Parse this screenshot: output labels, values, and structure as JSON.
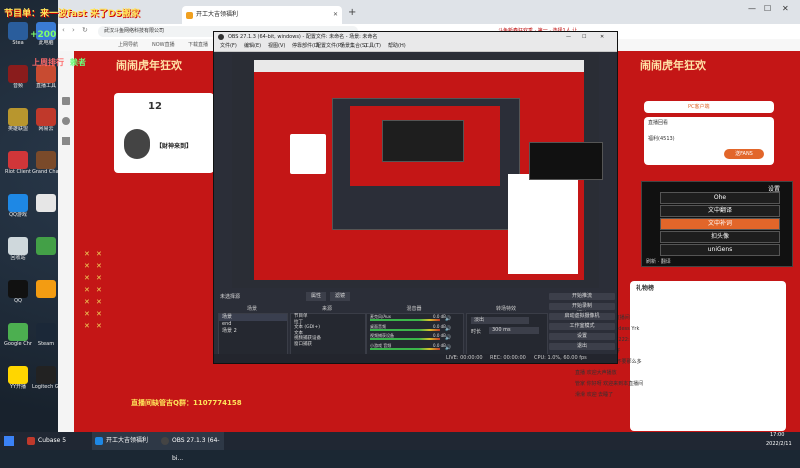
{
  "overlay": {
    "hint_line": "节目单：来一波fast 来了DS搬家",
    "plus_count": "+200",
    "hot_line": "上周排行",
    "hot_val": "赖者",
    "contact": "直播间缺管吉Q群：1107774158"
  },
  "desktop_icons": [
    {
      "label": "Stea",
      "color": "#2a5d9c"
    },
    {
      "label": "此电脑",
      "color": "#3a7bd5"
    },
    {
      "label": "音频",
      "color": "#8a1c1c"
    },
    {
      "label": "直播工具",
      "color": "#c84b31"
    },
    {
      "label": "英雄联盟",
      "color": "#b8962e"
    },
    {
      "label": "网易云",
      "color": "#c0392b"
    },
    {
      "label": "Riot Client",
      "color": "#d13639"
    },
    {
      "label": "Grand Chase",
      "color": "#7a4a2a"
    },
    {
      "label": "QQ游戏",
      "color": "#1e88e5"
    },
    {
      "label": "",
      "color": "#e6e6e6"
    },
    {
      "label": "回收站",
      "color": "#cfd8dc"
    },
    {
      "label": "",
      "color": "#43a047"
    },
    {
      "label": "QQ",
      "color": "#111111"
    },
    {
      "label": "",
      "color": "#f39c12"
    },
    {
      "label": "Google Chrome",
      "color": "#4caf50"
    },
    {
      "label": "Steam",
      "color": "#1b2838"
    },
    {
      "label": "YY开播",
      "color": "#ffd600"
    },
    {
      "label": "Logitech G HUB",
      "color": "#222222"
    }
  ],
  "browser": {
    "tabs": [
      {
        "label": "开工大吉领福利"
      }
    ],
    "address": "武汉斗鱼网络科技有限公司",
    "bookmarks": [
      "上网导航",
      "NOW直播",
      "下载直播"
    ],
    "ad_text": "斗鱼新春狂欢季 · 第一 · 选择1人 让",
    "page_banner": "闹闹虎年狂欢",
    "streamer_name": "【财神来到】",
    "follow_count": "12",
    "badges": [
      "PC客户端",
      "直播回看",
      "福利(4513)"
    ],
    "right_label": "礼物榜",
    "right_btn": "送FANS"
  },
  "obs": {
    "title": "OBS 27.1.3 (64-bit, windows) - 配置文件: 未命名 - 场景: 未命名",
    "menu": [
      "文件(F)",
      "编辑(E)",
      "视图(V)",
      "停靠部件(D)",
      "配置文件(P)",
      "场景集合(S)",
      "工具(T)",
      "帮助(H)"
    ],
    "status_label": "未选择源",
    "prop_btn": "属性",
    "filter_btn": "滤镜",
    "docks": {
      "scenes": "场景",
      "sources": "来源",
      "mixer": "混音器",
      "transitions": "转场特效",
      "controls": "控件"
    },
    "scene_items": [
      "场景",
      "end",
      "场景 2"
    ],
    "source_items": [
      "节目单",
      "拉丁",
      "文本 (GDI+)",
      "文本",
      "视频捕获设备",
      "窗口捕获"
    ],
    "mixer_items": [
      {
        "name": "麦克风/Aux",
        "db": "0.0 dB"
      },
      {
        "name": "桌面音频",
        "db": "0.0 dB"
      },
      {
        "name": "视频捕获设备",
        "db": "0.0 dB"
      },
      {
        "name": "小游戏 音频",
        "db": "0.0 dB"
      }
    ],
    "transition": {
      "type": "淡出",
      "duration_label": "时长",
      "duration": "300 ms"
    },
    "controls": [
      "开始推流",
      "开始录制",
      "启动虚拟摄像机",
      "工作室模式",
      "设置",
      "退出"
    ],
    "statusbar": {
      "live": "LIVE: 00:00:00",
      "rec": "REC: 00:00:00",
      "cpu": "CPU: 1.0%, 60.00 fps"
    }
  },
  "overlay_menu": {
    "title": "设置",
    "items": [
      "Ohe",
      "文中翻译",
      "文中补词",
      "扣头像",
      "uniGens"
    ],
    "highlighted_index": 2,
    "footer": "刷新 · 翻译"
  },
  "chat": {
    "lines": [
      "赖者 2154kc",
      "1日报 欢迎来到本直播间",
      "超级小明 欢迎 Goddess Yrk",
      "赖者 1111111111222:",
      "乐趣大老爷不知咋好",
      "为众人感叹 我们的不要那么多",
      "直播 欢迎大声播放",
      "管家 你好呀 欢迎来到本直播间",
      "滑滑 欢迎 去睡了"
    ]
  },
  "taskbar": {
    "items": [
      "Cubase 5",
      "开工大吉领福利",
      "OBS 27.1.3 (64-bi..."
    ],
    "time": "17:00",
    "date": "2022/2/11"
  },
  "colors": {
    "accent_red": "#c41616",
    "highlight_orange": "#e2662a",
    "obs_bg": "#2b2e38"
  }
}
